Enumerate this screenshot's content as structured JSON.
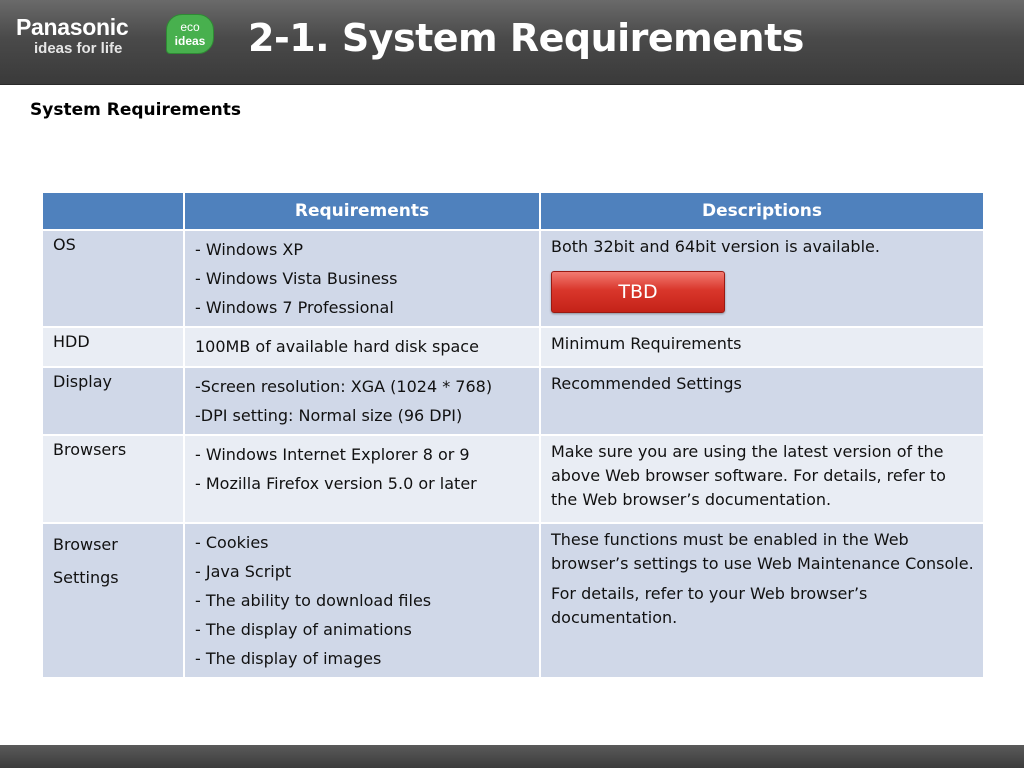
{
  "header": {
    "logo_main": "Panasonic",
    "logo_sub": "ideas for life",
    "eco_line1": "eco",
    "eco_line2": "ideas",
    "title": "2-1. System Requirements"
  },
  "subtitle": "System Requirements",
  "table": {
    "headers": [
      "",
      "Requirements",
      "Descriptions"
    ],
    "rows": [
      {
        "category": "OS",
        "requirements": [
          "- Windows XP",
          "- Windows Vista Business",
          "- Windows 7 Professional"
        ],
        "descriptions": [
          "Both 32bit and 64bit version is available."
        ],
        "badge": "TBD"
      },
      {
        "category": "HDD",
        "requirements": [
          "100MB of available hard disk space"
        ],
        "descriptions": [
          "Minimum Requirements"
        ]
      },
      {
        "category": "Display",
        "requirements": [
          "-Screen resolution: XGA (1024 * 768)",
          "-DPI setting: Normal size (96 DPI)"
        ],
        "descriptions": [
          "Recommended Settings"
        ]
      },
      {
        "category": "Browsers",
        "requirements": [
          "- Windows Internet Explorer 8 or 9",
          "- Mozilla Firefox version 5.0 or later"
        ],
        "descriptions": [
          "Make sure you are using the latest version of the above Web browser software. For details, refer to the Web browser’s documentation."
        ]
      },
      {
        "category_line1": "Browser",
        "category_line2": "Settings",
        "requirements": [
          "- Cookies",
          "- Java Script",
          "- The ability to download files",
          "- The display of animations",
          "- The display of images"
        ],
        "descriptions": [
          "These functions must be enabled in the Web browser’s settings to use Web Maintenance Console.",
          "For details, refer to your Web browser’s documentation."
        ]
      }
    ]
  },
  "colors": {
    "header_bg": "#4a4a4a",
    "table_header": "#4f81bd",
    "row_dark": "#d0d8e8",
    "row_light": "#e9edf4",
    "tbd_red": "#d9362b",
    "eco_green": "#48b04e"
  }
}
